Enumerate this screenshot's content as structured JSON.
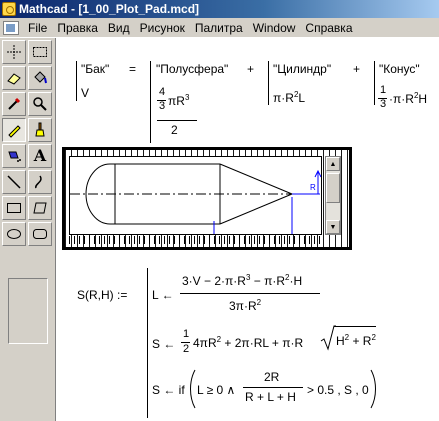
{
  "window": {
    "title": "Mathcad - [1_00_Plot_Pad.mcd]"
  },
  "menu": [
    "File",
    "Правка",
    "Вид",
    "Рисунок",
    "Палитра",
    "Window",
    "Справка"
  ],
  "palette": {
    "tools": [
      {
        "name": "selection-region-icon",
        "glyph": "✥"
      },
      {
        "name": "selection-rect-icon",
        "glyph": "▭"
      },
      {
        "name": "eraser-icon",
        "glyph": "▱"
      },
      {
        "name": "fill-bucket-icon",
        "glyph": "◈"
      },
      {
        "name": "eyedropper-icon",
        "glyph": "⁄"
      },
      {
        "name": "magnifier-icon",
        "glyph": "🔍"
      },
      {
        "name": "pencil-icon",
        "glyph": "✎"
      },
      {
        "name": "brush-icon",
        "glyph": "⍋"
      },
      {
        "name": "airbrush-icon",
        "glyph": "⚑"
      },
      {
        "name": "text-icon",
        "glyph": "A"
      },
      {
        "name": "line-icon",
        "glyph": "╲"
      },
      {
        "name": "curve-icon",
        "glyph": "∫"
      },
      {
        "name": "rectangle-icon",
        "glyph": "▭"
      },
      {
        "name": "polygon-icon",
        "glyph": "⏢"
      },
      {
        "name": "ellipse-icon",
        "glyph": "⬭"
      },
      {
        "name": "rounded-rect-icon",
        "glyph": "▢"
      }
    ]
  },
  "table": {
    "col1": {
      "r1": "\"Бак\"",
      "r2": "V"
    },
    "eq": "=",
    "col2": {
      "r1": "\"Полусфера\"",
      "num": "4",
      "den": "3",
      "expr_a": "πR",
      "exp": "3",
      "den2": "2"
    },
    "plus1": "+",
    "col3": {
      "r1": "\"Цилиндр\"",
      "expr": "π·R",
      "exp": "2",
      "tail": "L"
    },
    "plus2": "+",
    "col4": {
      "r1": "\"Конус\"",
      "num": "1",
      "den": "3",
      "expr": "·π·R",
      "exp": "2",
      "tail": "H"
    }
  },
  "program": {
    "lhs": "S(R,H) :=",
    "line1_lhs": "L ←",
    "line1_num": "3·V − 2·π·R",
    "line1_num_exp": "3",
    "line1_num_b": " − π·R",
    "line1_num_b_exp": "2",
    "line1_num_c": "·H",
    "line1_den": "3π·R",
    "line1_den_exp": "2",
    "line2_lhs": "S ←",
    "line2_num": "1",
    "line2_den": "2",
    "line2_a": "4πR",
    "line2_a_exp": "2",
    "line2_b": " + 2π·RL + π·R",
    "line2_sqrt_a": "H",
    "line2_sqrt_a_exp": "2",
    "line2_sqrt_b": " + R",
    "line2_sqrt_b_exp": "2",
    "line3_lhs": "S ← if",
    "line3_a": "L ≥ 0 ∧",
    "line3_num": "2R",
    "line3_den": "R + L + H",
    "line3_b": "> 0.5 , S , 0"
  },
  "plot_label": "R"
}
